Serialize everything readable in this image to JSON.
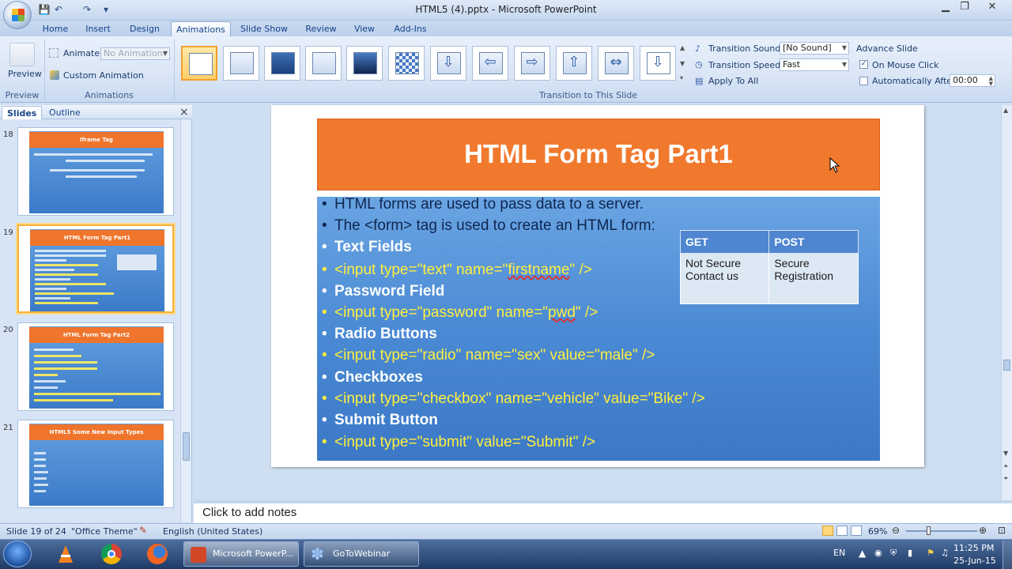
{
  "window": {
    "title": "HTML5 (4).pptx - Microsoft PowerPoint",
    "controls": {
      "minimize": "▁",
      "restore": "❐",
      "close": "✕"
    }
  },
  "quick_access": {
    "save": "💾",
    "undo": "↶",
    "redo": "↷",
    "customize": "▾"
  },
  "tabs": [
    "Home",
    "Insert",
    "Design",
    "Animations",
    "Slide Show",
    "Review",
    "View",
    "Add-Ins"
  ],
  "active_tab": "Animations",
  "ribbon": {
    "preview": {
      "label": "Preview",
      "group": "Preview"
    },
    "animations": {
      "animate_label": "Animate:",
      "animate_value": "No Animation",
      "custom_animation": "Custom Animation",
      "group": "Animations"
    },
    "transitions": {
      "group": "Transition to This Slide",
      "sound_label": "Transition Sound:",
      "sound_value": "[No Sound]",
      "speed_label": "Transition Speed:",
      "speed_value": "Fast",
      "apply_all": "Apply To All",
      "advance_label": "Advance Slide",
      "on_mouse_click": "On Mouse Click",
      "on_mouse_click_checked": true,
      "auto_after": "Automatically After:",
      "auto_after_checked": false,
      "auto_after_value": "00:00"
    }
  },
  "pane": {
    "tabs": [
      "Slides",
      "Outline"
    ],
    "close": "×",
    "slides": [
      {
        "number": "18",
        "title": "Iframe Tag"
      },
      {
        "number": "19",
        "title": "HTML Form Tag Part1"
      },
      {
        "number": "20",
        "title": "HTML Form Tag Part2"
      },
      {
        "number": "21",
        "title": "HTML5 Some New Input Types"
      }
    ]
  },
  "slide": {
    "title": "HTML Form Tag Part1",
    "bullets": [
      {
        "text": "HTML forms are used to pass data to a server.",
        "style": "dark"
      },
      {
        "text": "The <form> tag is used to create an HTML form:",
        "style": "dark"
      },
      {
        "text": "Text Fields",
        "style": "bold"
      },
      {
        "pre": "<input type=\"text\" name=\"",
        "ul": "firstname",
        "post": "\" />",
        "style": "yellow"
      },
      {
        "text": "Password Field",
        "style": "bold"
      },
      {
        "pre": "<input type=\"password\" name=\"",
        "ul": "pwd",
        "post": "\" />",
        "style": "yellow"
      },
      {
        "text": "Radio Buttons",
        "style": "bold"
      },
      {
        "text": "<input type=\"radio\" name=\"sex\" value=\"male\" />",
        "style": "yellow"
      },
      {
        "text": "Checkboxes",
        "style": "bold"
      },
      {
        "text": "<input type=\"checkbox\" name=\"vehicle\" value=\"Bike\" />",
        "style": "yellow"
      },
      {
        "text": "Submit Button",
        "style": "bold"
      },
      {
        "text": "<input type=\"submit\" value=\"Submit\" />",
        "style": "yellow"
      }
    ],
    "bullet_char": "•",
    "table": {
      "headers": [
        "GET",
        "POST"
      ],
      "cells": [
        [
          "Not Secure",
          "Contact us"
        ],
        [
          "Secure",
          "Registration"
        ]
      ]
    }
  },
  "notes_placeholder": "Click to add notes",
  "status": {
    "slide_count": "Slide 19 of 24",
    "theme": "\"Office Theme\"",
    "language": "English (United States)",
    "zoom": "69%"
  },
  "taskbar": {
    "apps": [
      "Microsoft PowerP...",
      "GoToWebinar"
    ],
    "lang": "EN",
    "time": "11:25 PM",
    "date": "25-Jun-15"
  },
  "colors": {
    "title_fill": "#f0792d",
    "code_text": "#ffef3d",
    "body_fill": "#4b8ad4"
  }
}
